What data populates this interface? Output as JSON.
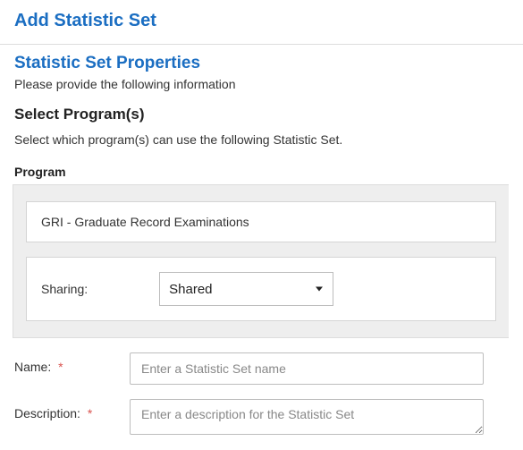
{
  "page_title": "Add Statistic Set",
  "section_title": "Statistic Set Properties",
  "section_helper": "Please provide the following information",
  "subsection_title": "Select Program(s)",
  "subsection_helper": "Select which program(s) can use the following Statistic Set.",
  "program": {
    "group_label": "Program",
    "selected_program": "GRI - Graduate Record Examinations",
    "sharing_label": "Sharing:",
    "sharing_value": "Shared"
  },
  "form": {
    "name_label": "Name:",
    "name_placeholder": "Enter a Statistic Set name",
    "description_label": "Description:",
    "description_placeholder": "Enter a description for the Statistic Set"
  },
  "required_mark": "*"
}
